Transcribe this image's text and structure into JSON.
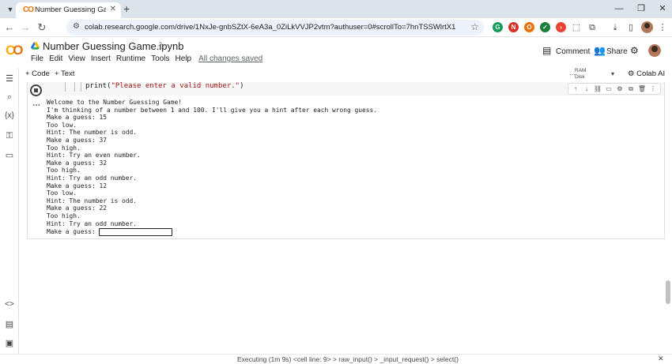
{
  "browser": {
    "tab_title": "Number Guessing Game.ipynb",
    "url": "colab.research.google.com/drive/1NxJe-gnbSZtX-6eA3a_0ZiLkVVJP2vtm?authuser=0#scrollTo=7hnTSSWlrtX1"
  },
  "header": {
    "notebook_title": "Number Guessing Game.ipynb",
    "menu": [
      "File",
      "Edit",
      "View",
      "Insert",
      "Runtime",
      "Tools",
      "Help"
    ],
    "save_status": "All changes saved",
    "comment_label": "Comment",
    "share_label": "Share"
  },
  "toolbar": {
    "code_label": "+ Code",
    "text_label": "+ Text",
    "ram_label": "RAM",
    "disk_label": "Disk",
    "colab_ai_label": "Colab AI"
  },
  "cell": {
    "code_line_prefix": "print(",
    "code_line_string": "\"Please enter a valid number.\"",
    "code_line_suffix": ")",
    "output_lines": [
      "Welcome to the Number Guessing Game!",
      "I'm thinking of a number between 1 and 100. I'll give you a hint after each wrong guess.",
      "Make a guess: 15",
      "Too low.",
      "Hint: The number is odd.",
      "Make a guess: 37",
      "Too high.",
      "Hint: Try an even number.",
      "Make a guess: 32",
      "Too high.",
      "Hint: Try an odd number.",
      "Make a guess: 12",
      "Too low.",
      "Hint: The number is odd.",
      "Make a guess: 22",
      "Too high.",
      "Hint: Try an odd number."
    ],
    "input_prompt": "Make a guess:",
    "input_value": ""
  },
  "status": {
    "text": "Executing (1m 9s)  <cell line: 9> > raw_input() > _input_request() > select()"
  },
  "icons": {
    "tab": "colab-logo-icon",
    "rail": [
      "table-of-contents-icon",
      "search-icon",
      "variables-icon",
      "secrets-key-icon",
      "files-folder-icon",
      "code-snippets-icon",
      "command-palette-icon",
      "terminal-icon"
    ]
  },
  "colors": {
    "colab_orange": "#e8710a",
    "colab_yellow": "#f9ab00",
    "omnibox_bg": "#edf2fa",
    "tabbar_bg": "#dde3ea"
  }
}
